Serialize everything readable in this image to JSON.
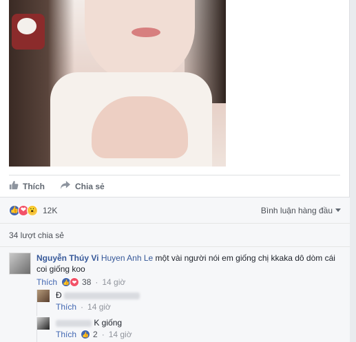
{
  "post": {
    "actions": {
      "like_label": "Thích",
      "share_label": "Chia sẻ"
    },
    "reactions": {
      "count": "12K",
      "sort_label": "Bình luận hàng đầu"
    },
    "shares_label": "34 lượt chia sẻ"
  },
  "comments": [
    {
      "author": "Nguyễn Thúy Vi",
      "tagged": "Huyen Anh Le",
      "text": " một vài người nói em giống chị kkaka dô dòm cái coi giống koo",
      "like_label": "Thích",
      "reaction_count": "38",
      "time": "14 giờ"
    }
  ],
  "replies": [
    {
      "text": "Đ",
      "like_label": "Thích",
      "time": "14 giờ"
    },
    {
      "text": "K giống",
      "like_label": "Thích",
      "reaction_count": "2",
      "time": "14 giờ"
    }
  ],
  "colors": {
    "link": "#365899",
    "like_blue": "#4267b2",
    "love_red": "#f25268",
    "wow_yellow": "#f7c94a"
  },
  "icons": [
    "thumbs-up-icon",
    "share-arrow-icon",
    "like-reaction-icon",
    "love-reaction-icon",
    "wow-reaction-icon",
    "caret-down-icon"
  ]
}
